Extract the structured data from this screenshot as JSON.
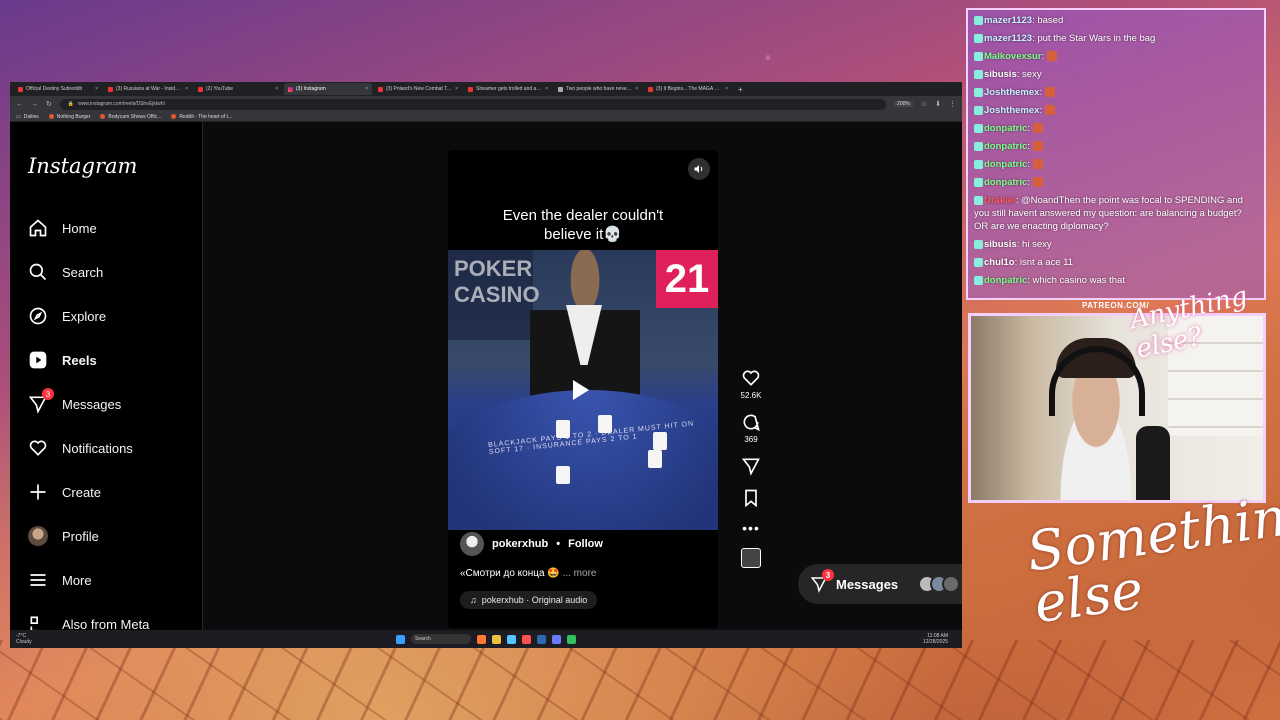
{
  "browser": {
    "tabs": [
      {
        "label": "Official Destiny Subreddit",
        "active": false,
        "fav": "reddit"
      },
      {
        "label": "(3) Russians at War - Inside a Ru...",
        "active": false,
        "fav": "youtube"
      },
      {
        "label": "(2) YouTube",
        "active": false,
        "fav": "youtube"
      },
      {
        "label": "(3) Instagram",
        "active": true,
        "fav": "instagram"
      },
      {
        "label": "(3) Poland's New Combat Tank...",
        "active": false,
        "fav": "youtube"
      },
      {
        "label": "Streamer gets trolled and acci...",
        "active": false,
        "fav": "youtube"
      },
      {
        "label": "Two people who have never be...",
        "active": false,
        "fav": "x"
      },
      {
        "label": "(3) It Begins... The MAGA Civil W...",
        "active": false,
        "fav": "youtube"
      }
    ],
    "new_tab": "+",
    "url": "www.instagram.com/reels/DShoEjktwh/",
    "zoom": "200%",
    "bookmarks": [
      "Dailies",
      "Nothing Burger",
      "Bodycam Shows Offic...",
      "Reddit - The heart of t..."
    ]
  },
  "instagram": {
    "logo": "Instagram",
    "nav": [
      {
        "label": "Home",
        "icon": "home-icon"
      },
      {
        "label": "Search",
        "icon": "search-icon"
      },
      {
        "label": "Explore",
        "icon": "compass-icon"
      },
      {
        "label": "Reels",
        "icon": "reels-icon"
      },
      {
        "label": "Messages",
        "icon": "messenger-icon",
        "badge": "3"
      },
      {
        "label": "Notifications",
        "icon": "heart-icon"
      },
      {
        "label": "Create",
        "icon": "plus-icon"
      },
      {
        "label": "Profile",
        "icon": "avatar"
      },
      {
        "label": "More",
        "icon": "menu-icon"
      },
      {
        "label": "Also from Meta",
        "icon": "meta-icon"
      }
    ],
    "reel": {
      "caption_line1": "Even the dealer couldn't",
      "caption_line2": "believe it💀",
      "video_number": "21",
      "video_sign": "POKER CASINO",
      "felt_text": "BLACKJACK PAYS 3 TO 2 · DEALER MUST HIT ON SOFT 17 · INSURANCE PAYS 2 TO 1",
      "author": "pokerxhub",
      "follow_label": "Follow",
      "separator": "•",
      "description": "«Смотри до конца 🤩",
      "more_label": "... more",
      "audio": "pokerxhub · Original audio"
    },
    "actions": {
      "likes": "52.6K",
      "comments": "369"
    },
    "messages_pill": {
      "label": "Messages",
      "badge": "3"
    }
  },
  "taskbar": {
    "weather_temp": "-7°C",
    "weather_desc": "Cloudy",
    "search_label": "Search",
    "time": "11:08 AM",
    "date": "12/28/2025"
  },
  "chat": [
    {
      "user": "mazer1123",
      "color": "#c6f0ff",
      "text": "based"
    },
    {
      "user": "mazer1123",
      "color": "#c6f0ff",
      "text": "put the Star Wars in the bag"
    },
    {
      "user": "Malkovexsur",
      "color": "#7cff8a",
      "text": ""
    },
    {
      "user": "sibusis",
      "color": "#ffffff",
      "text": "sexy"
    },
    {
      "user": "Joshthemex",
      "color": "#c6f0ff",
      "text": ""
    },
    {
      "user": "Joshthemex",
      "color": "#c6f0ff",
      "text": ""
    },
    {
      "user": "donpatric",
      "color": "#7cff8a",
      "text": ""
    },
    {
      "user": "donpatric",
      "color": "#7cff8a",
      "text": ""
    },
    {
      "user": "donpatric",
      "color": "#7cff8a",
      "text": ""
    },
    {
      "user": "donpatric",
      "color": "#7cff8a",
      "text": ""
    },
    {
      "user": "Drakiel",
      "color": "#ff5a5a",
      "text": "@NoandThen the point was focal to SPENDING and you still havent answered my question: are balancing a budget? OR are we enacting diplomacy?"
    },
    {
      "user": "sibusis",
      "color": "#ffffff",
      "text": "hi sexy"
    },
    {
      "user": "chul1o",
      "color": "#ffffff",
      "text": "isnt a ace 11"
    },
    {
      "user": "donpatric",
      "color": "#7cff8a",
      "text": "which casino was that"
    }
  ],
  "overlay": {
    "patreon": "PATREON.COM/",
    "brand_top": "Anything else?",
    "brand_bottom": "Something else"
  }
}
